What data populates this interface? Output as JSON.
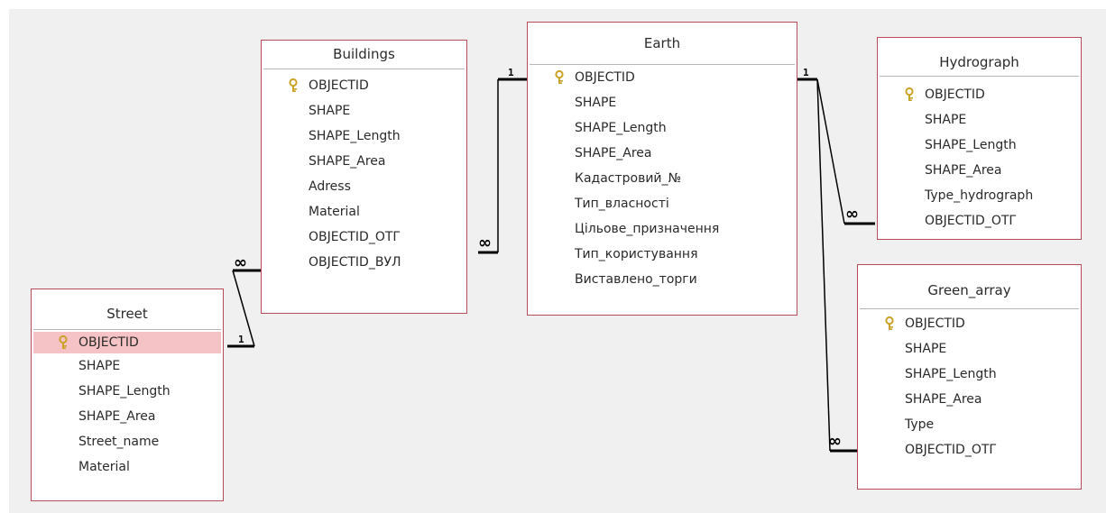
{
  "tables": {
    "buildings": {
      "title": "Buildings",
      "fields": [
        "OBJECTID",
        "SHAPE",
        "SHAPE_Length",
        "SHAPE_Area",
        "Adress",
        "Material",
        "OBJECTID_OTГ",
        "OBJECTID_ВУЛ"
      ]
    },
    "earth": {
      "title": "Earth",
      "fields": [
        "OBJECTID",
        "SHAPE",
        "SHAPE_Length",
        "SHAPE_Area",
        "Кадастровий_№",
        "Тип_власності",
        "Цільове_призначення",
        "Тип_користування",
        "Виставлено_торги"
      ]
    },
    "hydrograph": {
      "title": "Hydrograph",
      "fields": [
        "OBJECTID",
        "SHAPE",
        "SHAPE_Length",
        "SHAPE_Area",
        "Type_hydrograph",
        "OBJECTID_OTГ"
      ]
    },
    "green_array": {
      "title": "Green_array",
      "fields": [
        "OBJECTID",
        "SHAPE",
        "SHAPE_Length",
        "SHAPE_Area",
        "Type",
        "OBJECTID_OTГ"
      ]
    },
    "street": {
      "title": "Street",
      "fields": [
        "OBJECTID",
        "SHAPE",
        "SHAPE_Length",
        "SHAPE_Area",
        "Street_name",
        "Material"
      ]
    }
  },
  "relationships": {
    "one_label": "1",
    "many_label": "∞"
  },
  "colors": {
    "table_border": "#b84a5a",
    "selected_row": "#f5c3c5",
    "key_icon": "#c9a227",
    "canvas": "#f0f0f0"
  },
  "icons": {
    "primary_key": "key-icon"
  }
}
